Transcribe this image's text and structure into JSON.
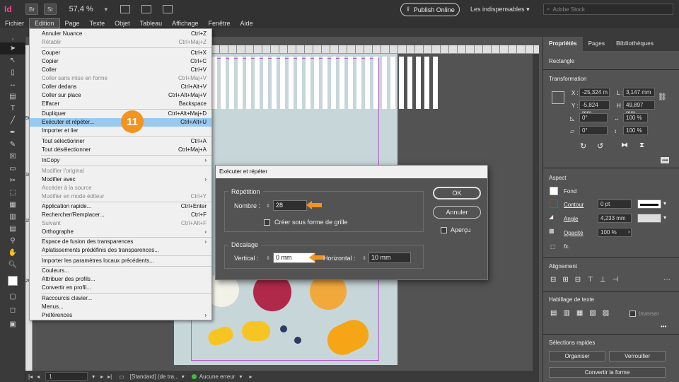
{
  "app": {
    "logo": "Id",
    "bridge": "Br",
    "stock": "St",
    "zoom": "57,4 %",
    "publish": "Publish Online",
    "workspace": "Les indispensables",
    "search_placeholder": "Adobe Stock"
  },
  "menubar": [
    "Fichier",
    "Edition",
    "Page",
    "Texte",
    "Objet",
    "Tableau",
    "Affichage",
    "Fenêtre",
    "Aide"
  ],
  "edit_menu": [
    {
      "label": "Annuler Nuance",
      "shortcut": "Ctrl+Z"
    },
    {
      "label": "Rétablir",
      "shortcut": "Ctrl+Maj+Z"
    },
    {
      "label": "Couper",
      "shortcut": "Ctrl+X"
    },
    {
      "label": "Copier",
      "shortcut": "Ctrl+C"
    },
    {
      "label": "Coller",
      "shortcut": "Ctrl+V"
    },
    {
      "label": "Coller sans mise en forme",
      "shortcut": "Ctrl+Maj+V"
    },
    {
      "label": "Coller dedans",
      "shortcut": "Ctrl+Alt+V"
    },
    {
      "label": "Coller sur place",
      "shortcut": "Ctrl+Alt+Maj+V"
    },
    {
      "label": "Effacer",
      "shortcut": "Backspace"
    },
    {
      "label": "Dupliquer",
      "shortcut": "Ctrl+Alt+Maj+D"
    },
    {
      "label": "Exécuter et répéter...",
      "shortcut": "Ctrl+Alt+U"
    },
    {
      "label": "Importer et lier",
      "shortcut": ""
    },
    {
      "label": "Tout sélectionner",
      "shortcut": "Ctrl+A"
    },
    {
      "label": "Tout désélectionner",
      "shortcut": "Ctrl+Maj+A"
    },
    {
      "label": "InCopy",
      "shortcut": "›"
    },
    {
      "label": "Modifier l'original",
      "shortcut": ""
    },
    {
      "label": "Modifier avec",
      "shortcut": "›"
    },
    {
      "label": "Accéder à la source",
      "shortcut": ""
    },
    {
      "label": "Modifier en mode éditeur",
      "shortcut": "Ctrl+Y"
    },
    {
      "label": "Application rapide...",
      "shortcut": "Ctrl+Enter"
    },
    {
      "label": "Rechercher/Remplacer...",
      "shortcut": "Ctrl+F"
    },
    {
      "label": "Suivant",
      "shortcut": "Ctrl+Alt+F"
    },
    {
      "label": "Orthographe",
      "shortcut": "›"
    },
    {
      "label": "Espace de fusion des transparences",
      "shortcut": "›"
    },
    {
      "label": "Aplatissements prédéfinis des transparences...",
      "shortcut": ""
    },
    {
      "label": "Importer les paramètres locaux précédents...",
      "shortcut": ""
    },
    {
      "label": "Couleurs...",
      "shortcut": ""
    },
    {
      "label": "Attribuer des profils...",
      "shortcut": ""
    },
    {
      "label": "Convertir en profil...",
      "shortcut": ""
    },
    {
      "label": "Raccourcis clavier...",
      "shortcut": ""
    },
    {
      "label": "Menus...",
      "shortcut": ""
    },
    {
      "label": "Préférences",
      "shortcut": "›"
    }
  ],
  "badge": "11",
  "dialog": {
    "title": "Exécuter et répéter",
    "repetition_label": "Répétition",
    "nombre_label": "Nombre :",
    "nombre_value": "28",
    "grid_label": "Créer sous forme de grille",
    "decalage_label": "Décalage",
    "vertical_label": "Vertical :",
    "vertical_value": "0 mm",
    "horizontal_label": "Horizontal :",
    "horizontal_value": "10 mm",
    "ok": "OK",
    "cancel": "Annuler",
    "preview": "Aperçu",
    "arrow_color": "#f39320"
  },
  "ruler": {
    "left_labels": [
      "0",
      "50",
      "100",
      "150",
      "200"
    ]
  },
  "status": {
    "page": "1",
    "style": "[Standard] (de tra...",
    "errors": "Aucune erreur"
  },
  "panel": {
    "tabs": [
      "Propriétés",
      "Pages",
      "Bibliothèques"
    ],
    "object": "Rectangle",
    "transform": "Transformation",
    "x_label": "X :",
    "x": "-25,324 m",
    "y_label": "Y :",
    "y": "-5,824 mm",
    "w_label": "L :",
    "w": "3,147 mm",
    "h_label": "H :",
    "h": "49,897 mm",
    "rot": "0°",
    "shear": "0°",
    "scale_x": "100 %",
    "scale_y": "100 %",
    "aspect": "Aspect",
    "fond": "Fond",
    "contour": "Contour",
    "stroke_w": "0 pt",
    "angle": "Angle",
    "angle_v": "4,233 mm",
    "opacite": "Opacité",
    "opacite_v": "100 %",
    "fx": "fx.",
    "alignment": "Alignement",
    "wrap": "Habillage de texte",
    "inverse": "Inverser",
    "quick": "Sélections rapides",
    "organiser": "Organiser",
    "verrouiller": "Verrouiller",
    "convert": "Convertir la forme"
  }
}
